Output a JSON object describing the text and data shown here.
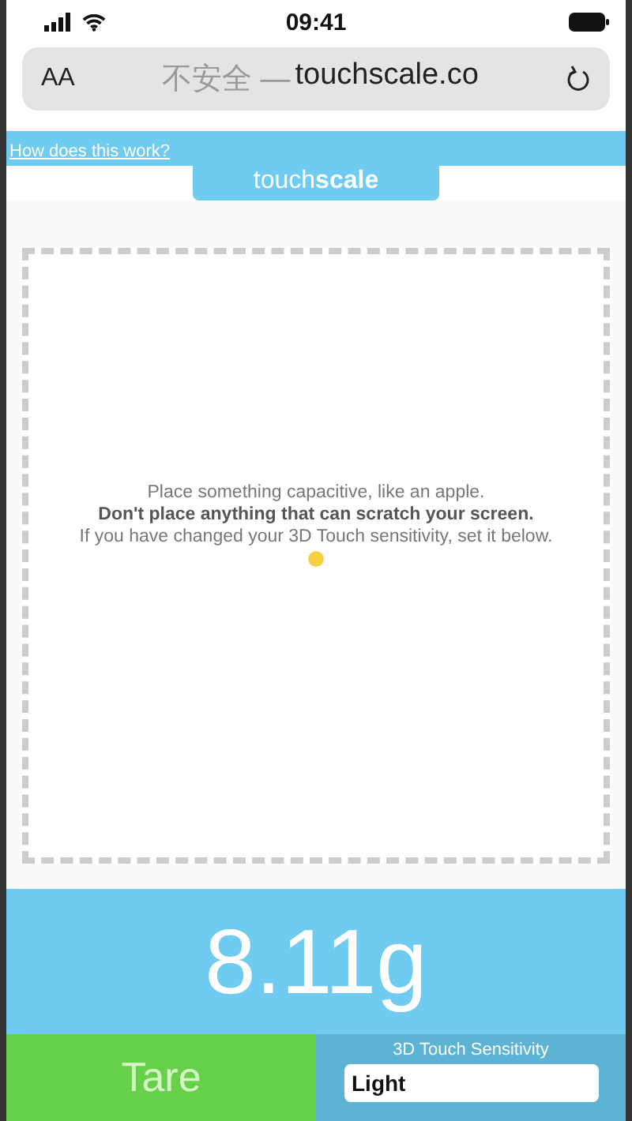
{
  "status_bar": {
    "time": "09:41"
  },
  "browser": {
    "text_size_button": "AA",
    "security_label": "不安全 —",
    "host": "touchscale.co"
  },
  "page": {
    "help_link": "How does this work?",
    "logo": "touch**scale**",
    "instructions": [
      {
        "text": "Place something capacitive, like an apple.",
        "kind": "normal"
      },
      {
        "text": "Don't place anything that can scratch your screen.",
        "kind": "warning"
      },
      {
        "text": "If you have changed your 3D Touch sensitivity, set it below.",
        "kind": "normal"
      }
    ],
    "reading": "8.11g",
    "tare_button": "Tare",
    "sensitivity": {
      "label": "3D Touch Sensitivity",
      "value": "Light"
    }
  }
}
